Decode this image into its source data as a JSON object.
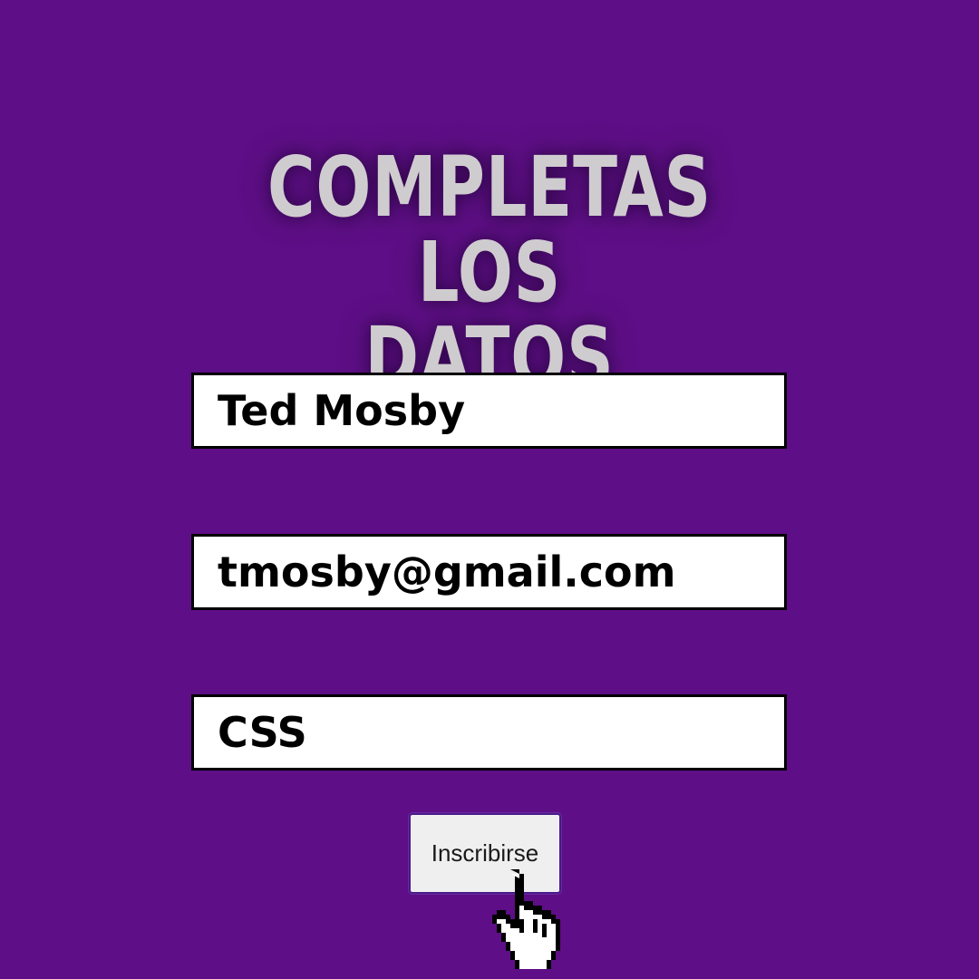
{
  "heading": {
    "line1": "COMPLETAS LOS",
    "line2": "DATOS"
  },
  "form": {
    "name_value": "Ted Mosby",
    "email_value": "tmosby@gmail.com",
    "course_value": "CSS",
    "submit_label": "Inscribirse"
  },
  "colors": {
    "background": "#5e0e86",
    "heading": "#cfcccf",
    "field_bg": "#ffffff",
    "field_border": "#000000",
    "button_bg": "#efefef"
  },
  "icons": {
    "cursor": "hand-pointer-icon"
  }
}
